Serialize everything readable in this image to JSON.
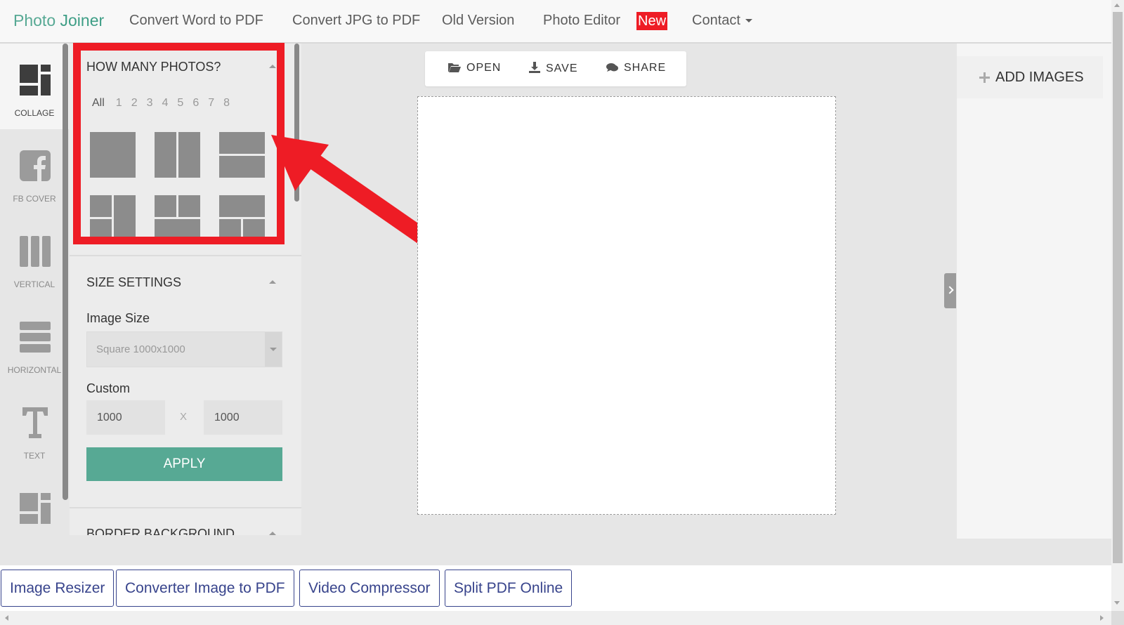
{
  "nav": {
    "brand_part1": "Photo ",
    "brand_part2": "Joiner",
    "links": [
      "Convert Word to PDF",
      "Convert JPG to PDF",
      "Old Version",
      "Photo Editor",
      "Contact"
    ],
    "new_badge": "New",
    "brand_color": "#57a994",
    "badge_color": "#ee1c25"
  },
  "rail": {
    "items": [
      {
        "label": "COLLAGE",
        "icon": "collage-icon",
        "active": true
      },
      {
        "label": "FB COVER",
        "icon": "facebook-icon"
      },
      {
        "label": "VERTICAL",
        "icon": "vertical-layout-icon"
      },
      {
        "label": "HORIZONTAL",
        "icon": "horizontal-layout-icon"
      },
      {
        "label": "TEXT",
        "icon": "text-icon"
      },
      {
        "label": "",
        "icon": "template-icon"
      }
    ]
  },
  "panel": {
    "photos_title": "HOW MANY PHOTOS?",
    "counts": [
      "All",
      "1",
      "2",
      "3",
      "4",
      "5",
      "6",
      "7",
      "8"
    ],
    "selected_count": "All",
    "size_title": "SIZE SETTINGS",
    "image_size_label": "Image Size",
    "image_size_value": "Square 1000x1000",
    "custom_label": "Custom",
    "width_value": "1000",
    "times": "X",
    "height_value": "1000",
    "apply_label": "APPLY",
    "border_title": "BORDER BACKGROUND",
    "accent_color": "#57a994"
  },
  "toolbar": {
    "open_label": "OPEN",
    "save_label": "SAVE",
    "share_label": "SHARE"
  },
  "right_panel": {
    "add_images_label": "ADD IMAGES"
  },
  "bottom_links": [
    "Image Resizer",
    "Converter Image to PDF",
    "Video Compressor",
    "Split PDF Online"
  ],
  "annotation": {
    "highlight_color": "#ee1c25"
  }
}
